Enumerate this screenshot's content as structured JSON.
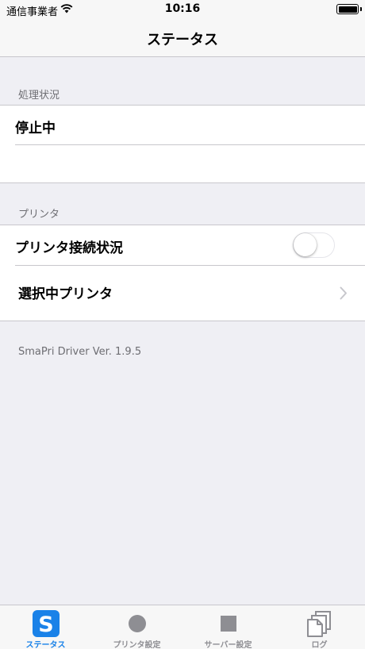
{
  "status_bar": {
    "carrier": "通信事業者",
    "time": "10:16"
  },
  "nav": {
    "title": "ステータス"
  },
  "processing": {
    "header": "処理状況",
    "status": "停止中"
  },
  "printer": {
    "header": "プリンタ",
    "connection_label": "プリンタ接続状況",
    "connection_on": false,
    "selected_label": "選択中プリンタ"
  },
  "version": "SmaPri Driver Ver. 1.9.5",
  "tabs": [
    {
      "label": "ステータス",
      "icon": "status-s-icon",
      "active": true
    },
    {
      "label": "プリンタ設定",
      "icon": "circle-icon",
      "active": false
    },
    {
      "label": "サーバー設定",
      "icon": "square-icon",
      "active": false
    },
    {
      "label": "ログ",
      "icon": "documents-icon",
      "active": false
    }
  ],
  "colors": {
    "accent": "#1a82e8",
    "inactive": "#8e8e93",
    "background": "#efeff4"
  }
}
